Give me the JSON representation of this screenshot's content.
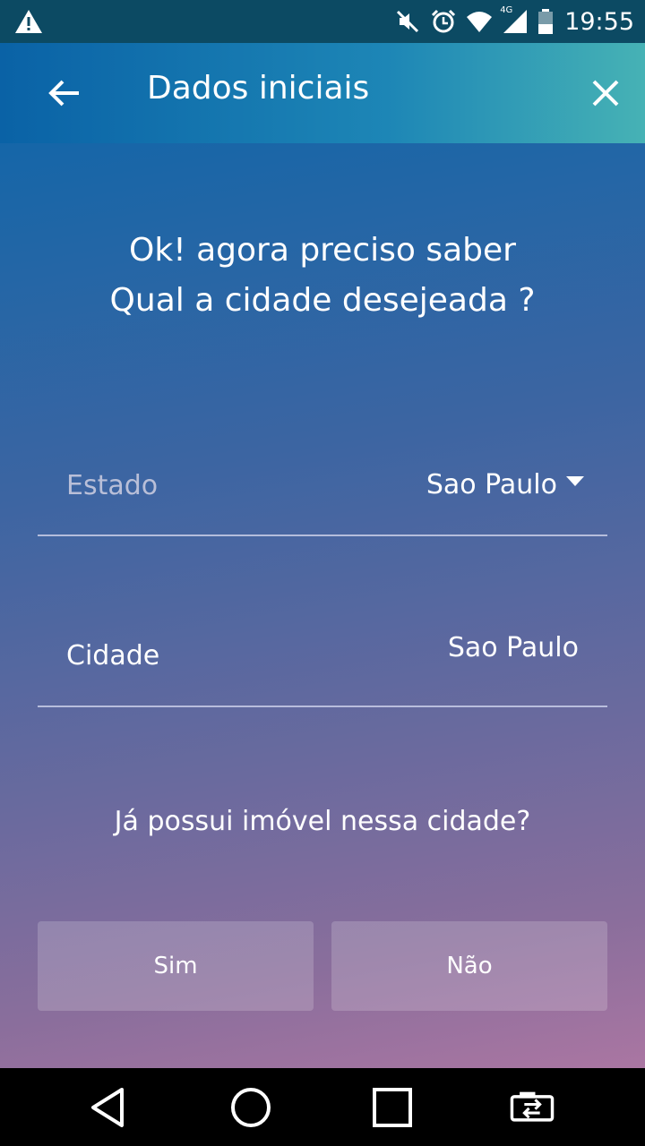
{
  "status_bar": {
    "time": "19:55",
    "network": "4G",
    "icons": [
      "warning-icon",
      "mute-icon",
      "alarm-icon",
      "wifi-icon",
      "signal-icon",
      "battery-icon"
    ]
  },
  "toolbar": {
    "title": "Dados iniciais",
    "back_icon": "arrow-left-icon",
    "close_icon": "close-icon"
  },
  "main": {
    "question_line1": "Ok! agora preciso saber",
    "question_line2": "Qual a cidade desejeada ?",
    "estado": {
      "label": "Estado",
      "value": "Sao Paulo"
    },
    "cidade": {
      "label": "Cidade",
      "value": "Sao Paulo"
    },
    "subquestion": "Já possui imóvel nessa cidade?",
    "buttons": {
      "yes": "Sim",
      "no": "Não"
    }
  },
  "colors": {
    "status_bar": "#0c4a63",
    "toolbar_start": "#0a62a6",
    "toolbar_end": "#46b2b5",
    "background_top": "#1566a8",
    "background_bottom": "#aa76a2"
  },
  "nav_bar": {
    "icons": [
      "back-triangle-icon",
      "home-circle-icon",
      "recents-square-icon",
      "switch-app-icon"
    ]
  }
}
